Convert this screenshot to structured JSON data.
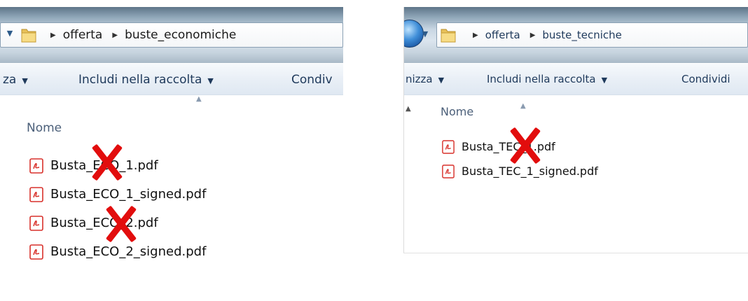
{
  "left_window": {
    "breadcrumb": [
      "offerta",
      "buste_economiche"
    ],
    "toolbar": {
      "organize_partial": "za",
      "include_label": "Includi nella raccolta",
      "share_partial": "Condiv"
    },
    "column_header": "Nome",
    "files": [
      {
        "name": "Busta_ECO_1.pdf",
        "crossed_out": true
      },
      {
        "name": "Busta_ECO_1_signed.pdf",
        "crossed_out": false
      },
      {
        "name": "Busta_ECO_2.pdf",
        "crossed_out": true
      },
      {
        "name": "Busta_ECO_2_signed.pdf",
        "crossed_out": false
      }
    ]
  },
  "right_window": {
    "breadcrumb": [
      "offerta",
      "buste_tecniche"
    ],
    "toolbar": {
      "organize_partial": "nizza",
      "include_label": "Includi nella raccolta",
      "share_partial": "Condividi"
    },
    "column_header": "Nome",
    "files": [
      {
        "name": "Busta_TEC_1.pdf",
        "crossed_out": true
      },
      {
        "name": "Busta_TEC_1_signed.pdf",
        "crossed_out": false
      }
    ]
  },
  "icons": {
    "folder": "folder-icon",
    "pdf": "pdf-file-icon",
    "cross": "red-x-mark",
    "breadcrumb_separator": "chevron-right-icon",
    "dropdown": "chevron-down-icon"
  },
  "colors": {
    "cross_mark": "#e20d0d",
    "pdf_icon": "#d8312b",
    "header_text": "#4c607a",
    "toolbar_text": "#1e395b"
  }
}
